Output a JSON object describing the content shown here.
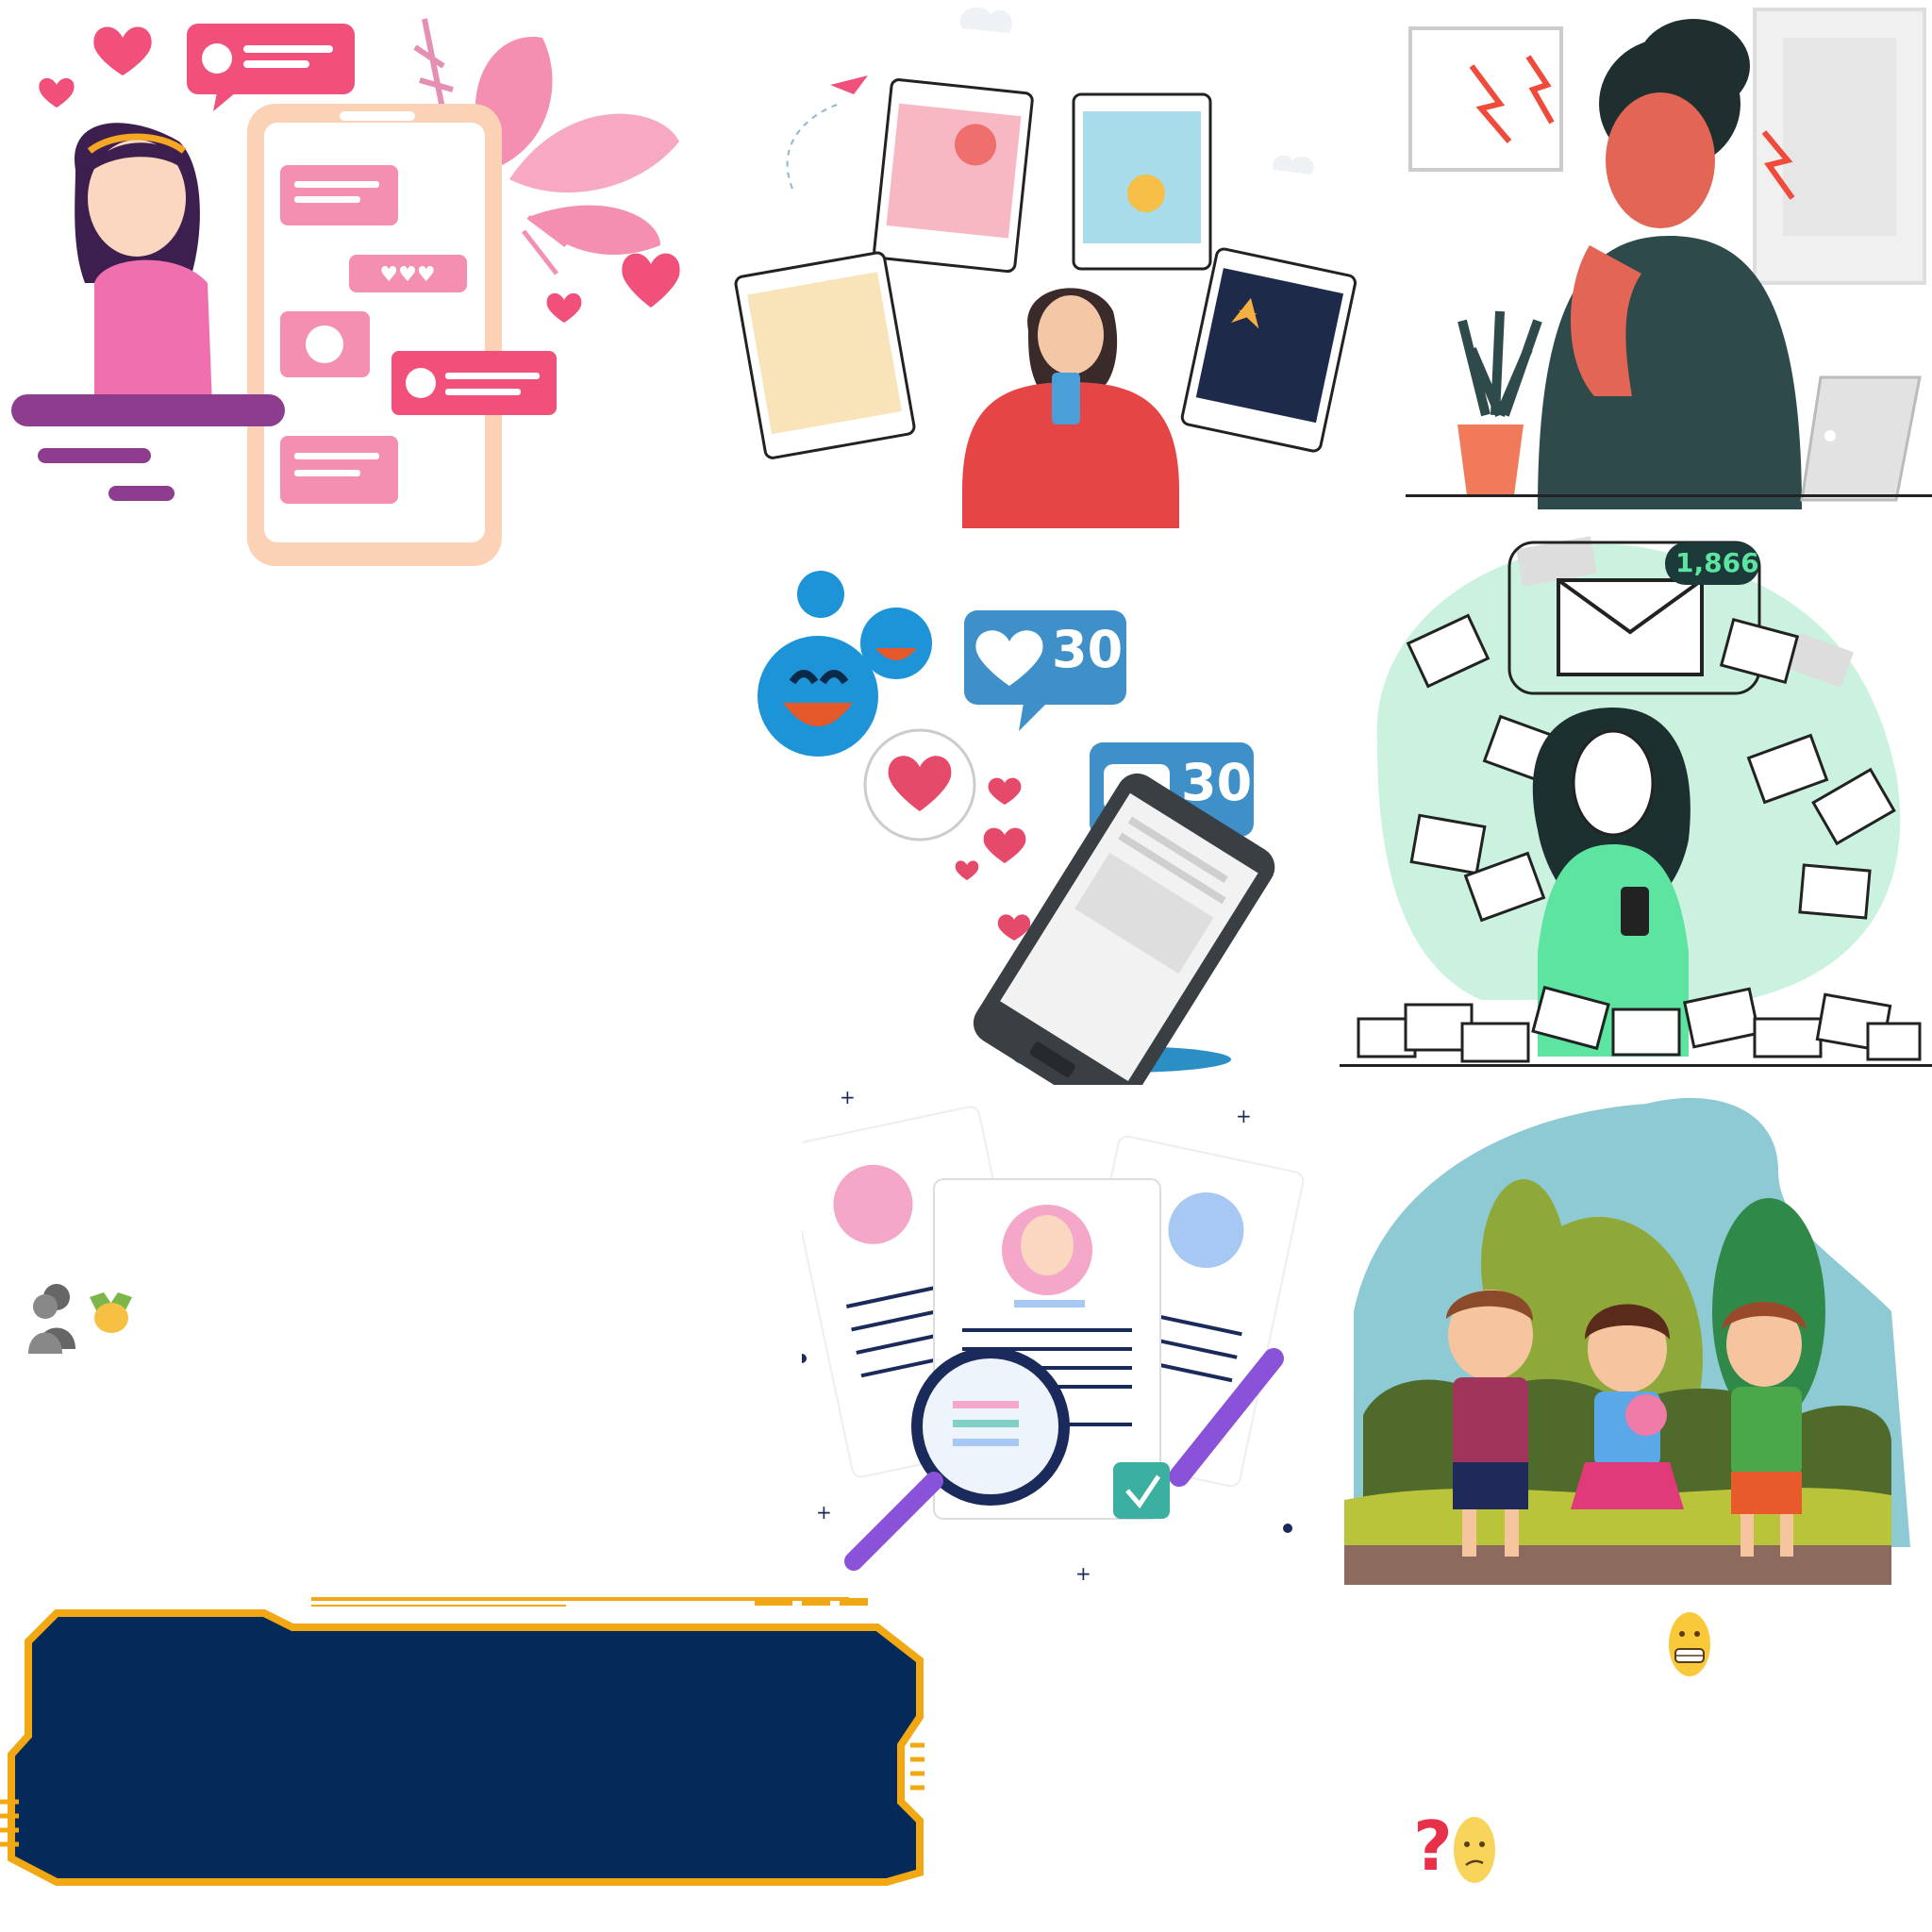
{
  "illustrations": [
    {
      "id": "phone-chat-girl",
      "icon": "chat-girl-illustration"
    },
    {
      "id": "social-photos-woman",
      "icon": "social-feed-illustration"
    },
    {
      "id": "headache-woman",
      "icon": "headache-illustration"
    },
    {
      "id": "likes-comments-phone",
      "icon": "engagement-illustration"
    },
    {
      "id": "email-overload-woman",
      "icon": "email-overload-illustration"
    },
    {
      "id": "profile-search",
      "icon": "profile-search-illustration"
    },
    {
      "id": "kids-park",
      "icon": "kids-park-illustration"
    },
    {
      "id": "game-frame-panel",
      "icon": "frame-panel"
    }
  ],
  "badges": {
    "likes_count": "30",
    "comments_count": "30",
    "email_count": "1,866"
  },
  "emojis": {
    "grimace": "😬",
    "question": "?",
    "confused": "😕",
    "people": "👥",
    "handshake": "🤝"
  },
  "colors": {
    "pink": "#f0507a",
    "frame_navy": "#042a5a",
    "frame_gold": "#f2a812",
    "badge_blue": "#3f8fc9",
    "email_green": "#5ce4a0"
  }
}
